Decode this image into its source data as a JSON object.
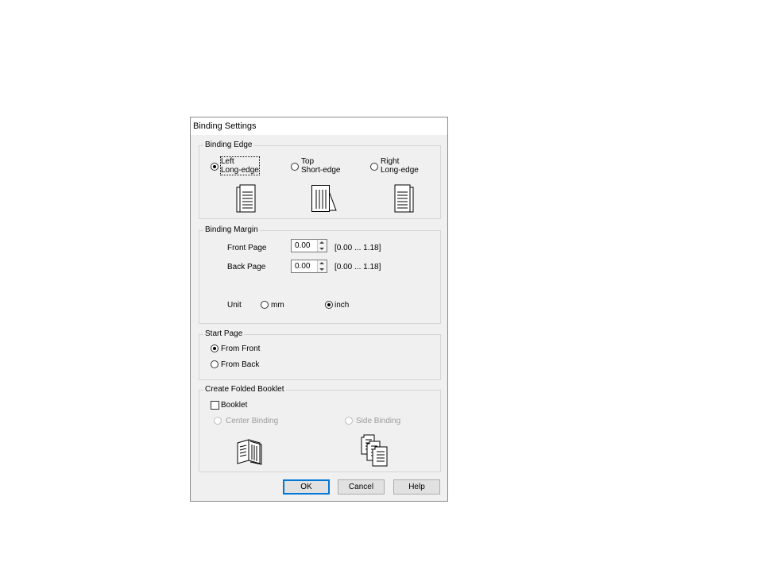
{
  "dialog": {
    "title": "Binding Settings"
  },
  "binding_edge": {
    "legend": "Binding Edge",
    "options": [
      {
        "line1": "Left",
        "line2": "Long-edge",
        "selected": true
      },
      {
        "line1": "Top",
        "line2": "Short-edge",
        "selected": false
      },
      {
        "line1": "Right",
        "line2": "Long-edge",
        "selected": false
      }
    ]
  },
  "binding_margin": {
    "legend": "Binding Margin",
    "front_label": "Front Page",
    "front_value": "0.00",
    "front_range": "[0.00 ... 1.18]",
    "back_label": "Back Page",
    "back_value": "0.00",
    "back_range": "[0.00 ... 1.18]",
    "unit_label": "Unit",
    "unit_mm": "mm",
    "unit_inch": "inch",
    "unit_selected": "inch"
  },
  "start_page": {
    "legend": "Start Page",
    "from_front": "From Front",
    "from_back": "From Back",
    "selected": "From Front"
  },
  "booklet": {
    "legend": "Create Folded Booklet",
    "checkbox_label": "Booklet",
    "checked": false,
    "center_binding": "Center Binding",
    "side_binding": "Side Binding"
  },
  "buttons": {
    "ok": "OK",
    "cancel": "Cancel",
    "help": "Help"
  },
  "icons": [
    "left-long-edge-icon",
    "top-short-edge-icon",
    "right-long-edge-icon",
    "center-binding-icon",
    "side-binding-icon"
  ]
}
